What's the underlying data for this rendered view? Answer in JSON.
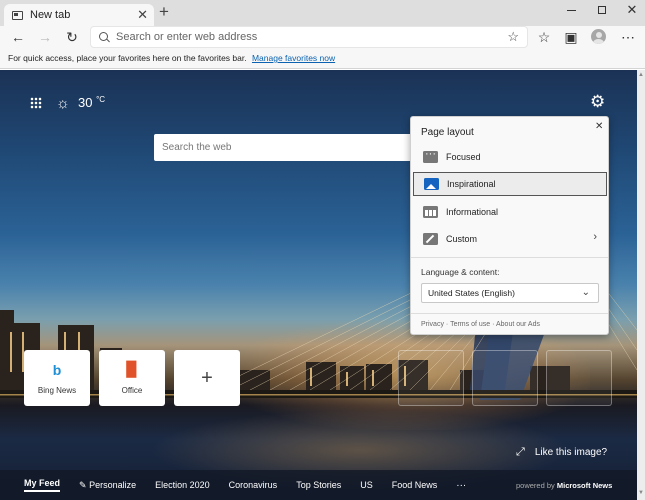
{
  "browser": {
    "tab_title": "New tab",
    "close_glyph": "✕",
    "new_tab_glyph": "+",
    "address_placeholder": "Search or enter web address",
    "favorites_bar_text": "For quick access, place your favorites here on the favorites bar.",
    "favorites_bar_link": "Manage favorites now"
  },
  "toolbar_icons": {
    "back": "←",
    "forward": "→",
    "refresh": "↻",
    "star": "☆",
    "favorites": "☆",
    "collections": "▣",
    "menu": "⋯"
  },
  "newtab": {
    "temperature": "30",
    "temperature_unit": "°C",
    "weather_glyph": "☼",
    "gear_glyph": "⚙",
    "search_placeholder": "Search the web",
    "quick_links": [
      {
        "label": "Bing News",
        "glyph": "b",
        "color": "#1f8fd6"
      },
      {
        "label": "Office",
        "glyph": "▉",
        "color": "#e0532a"
      }
    ],
    "add_glyph": "+",
    "expand_glyph": "⤢",
    "like_image": "Like this image?",
    "nav": [
      "My Feed",
      "Personalize",
      "Election 2020",
      "Coronavirus",
      "Top Stories",
      "US",
      "Food News"
    ],
    "nav_more": "···",
    "powered_prefix": "powered by",
    "powered_brand": "Microsoft News"
  },
  "page_layout": {
    "title": "Page layout",
    "close_glyph": "✕",
    "options": [
      {
        "label": "Focused",
        "icon": "focused-icon",
        "selected": false
      },
      {
        "label": "Inspirational",
        "icon": "inspirational-icon",
        "selected": true
      },
      {
        "label": "Informational",
        "icon": "informational-icon",
        "selected": false
      },
      {
        "label": "Custom",
        "icon": "custom-icon",
        "selected": false
      }
    ],
    "custom_chevron": "›",
    "language_label": "Language & content:",
    "language_value": "United States (English)",
    "select_chevron": "⌄",
    "footer": [
      "Privacy",
      "Terms of use",
      "About our Ads"
    ],
    "footer_sep": " · "
  },
  "colors": {
    "link": "#0a62b0",
    "selected_icon": "#1565c0"
  }
}
